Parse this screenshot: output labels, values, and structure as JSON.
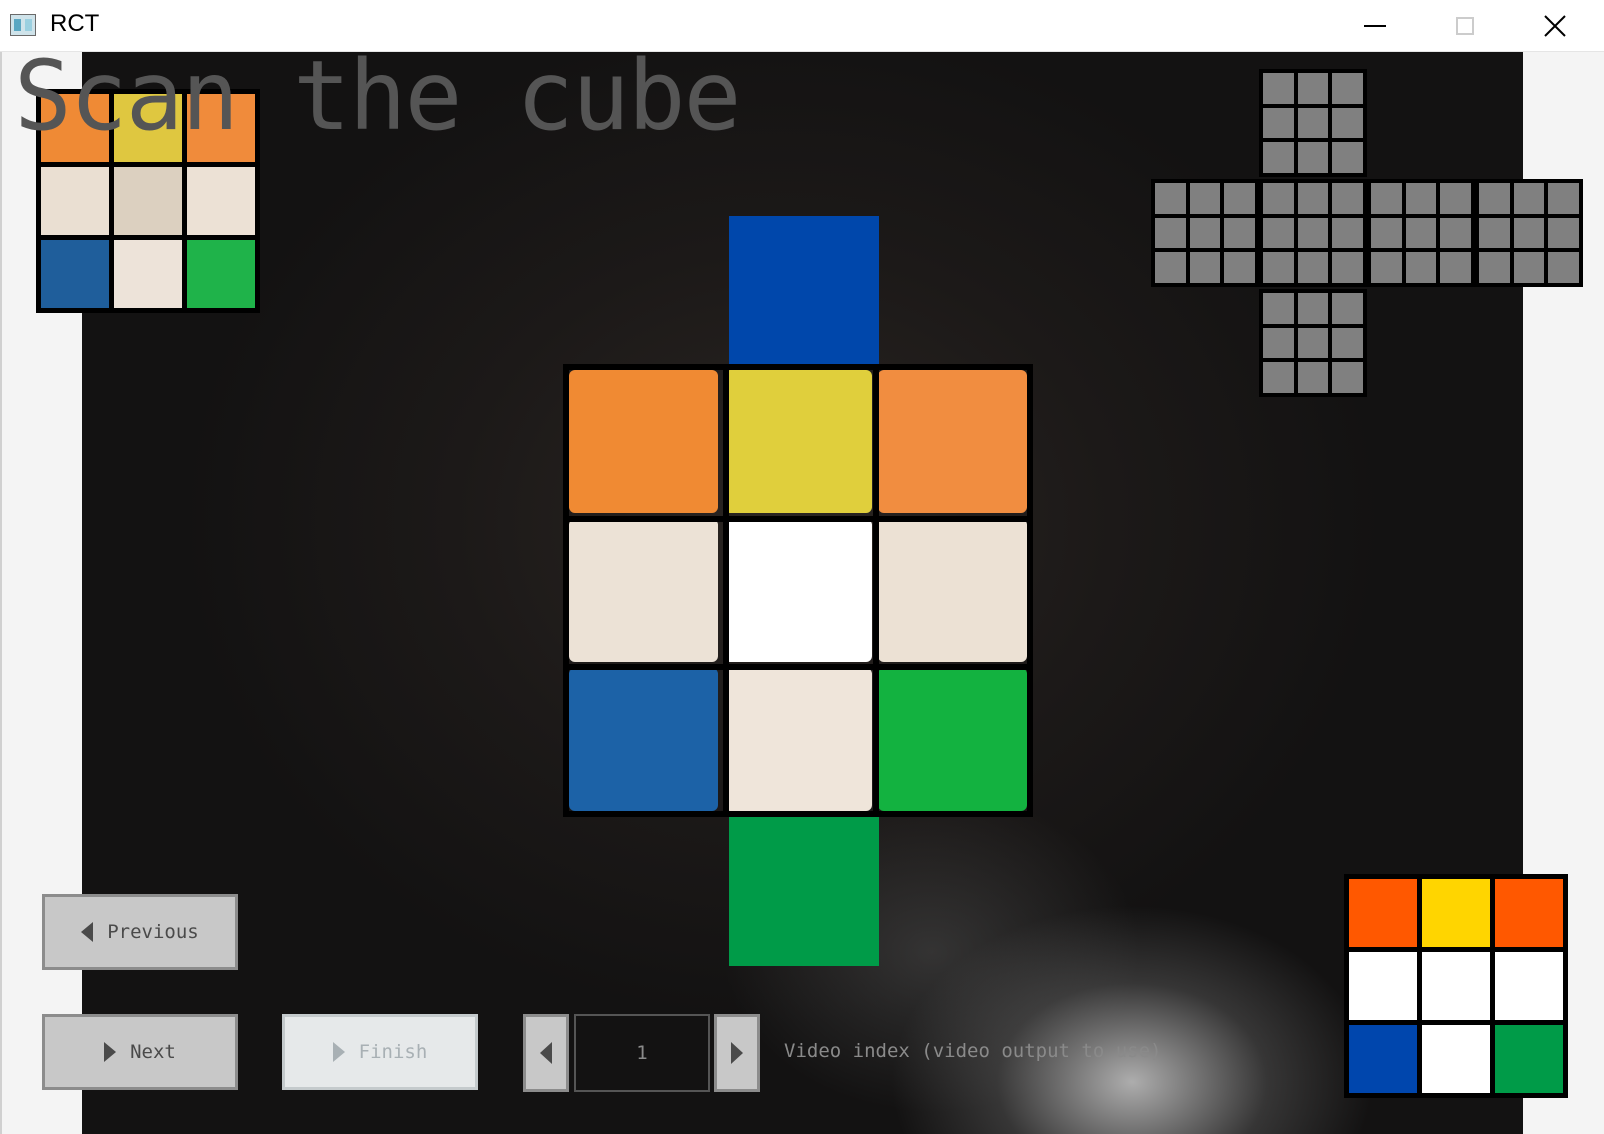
{
  "window": {
    "title": "RCT"
  },
  "header": {
    "title": "Scan the cube"
  },
  "colors": {
    "net_placeholder": "#808080",
    "neighbor_top": "#0047ab",
    "neighbor_bottom": "#009b48"
  },
  "scanned_face": {
    "stickers": [
      "#ef8a35",
      "#dfc740",
      "#f08b3b",
      "#eadfd2",
      "#dcd0c0",
      "#ece1d5",
      "#1f5e9b",
      "#ede3d9",
      "#1fb34a"
    ]
  },
  "video_face": {
    "stickers": [
      "#f08a33",
      "#e0cf3c",
      "#f18d40",
      "#ece2d6",
      "#ffffff",
      "#ece1d4",
      "#1c62a7",
      "#efe5da",
      "#13b240"
    ]
  },
  "reference_face": {
    "stickers": [
      "#ff5800",
      "#ffd500",
      "#ff5800",
      "#ffffff",
      "#ffffff",
      "#ffffff",
      "#0046ad",
      "#ffffff",
      "#009b48"
    ]
  },
  "controls": {
    "previous_label": "Previous",
    "next_label": "Next",
    "finish_label": "Finish",
    "video_index_value": "1",
    "video_index_label": "Video index (video output to use)"
  }
}
